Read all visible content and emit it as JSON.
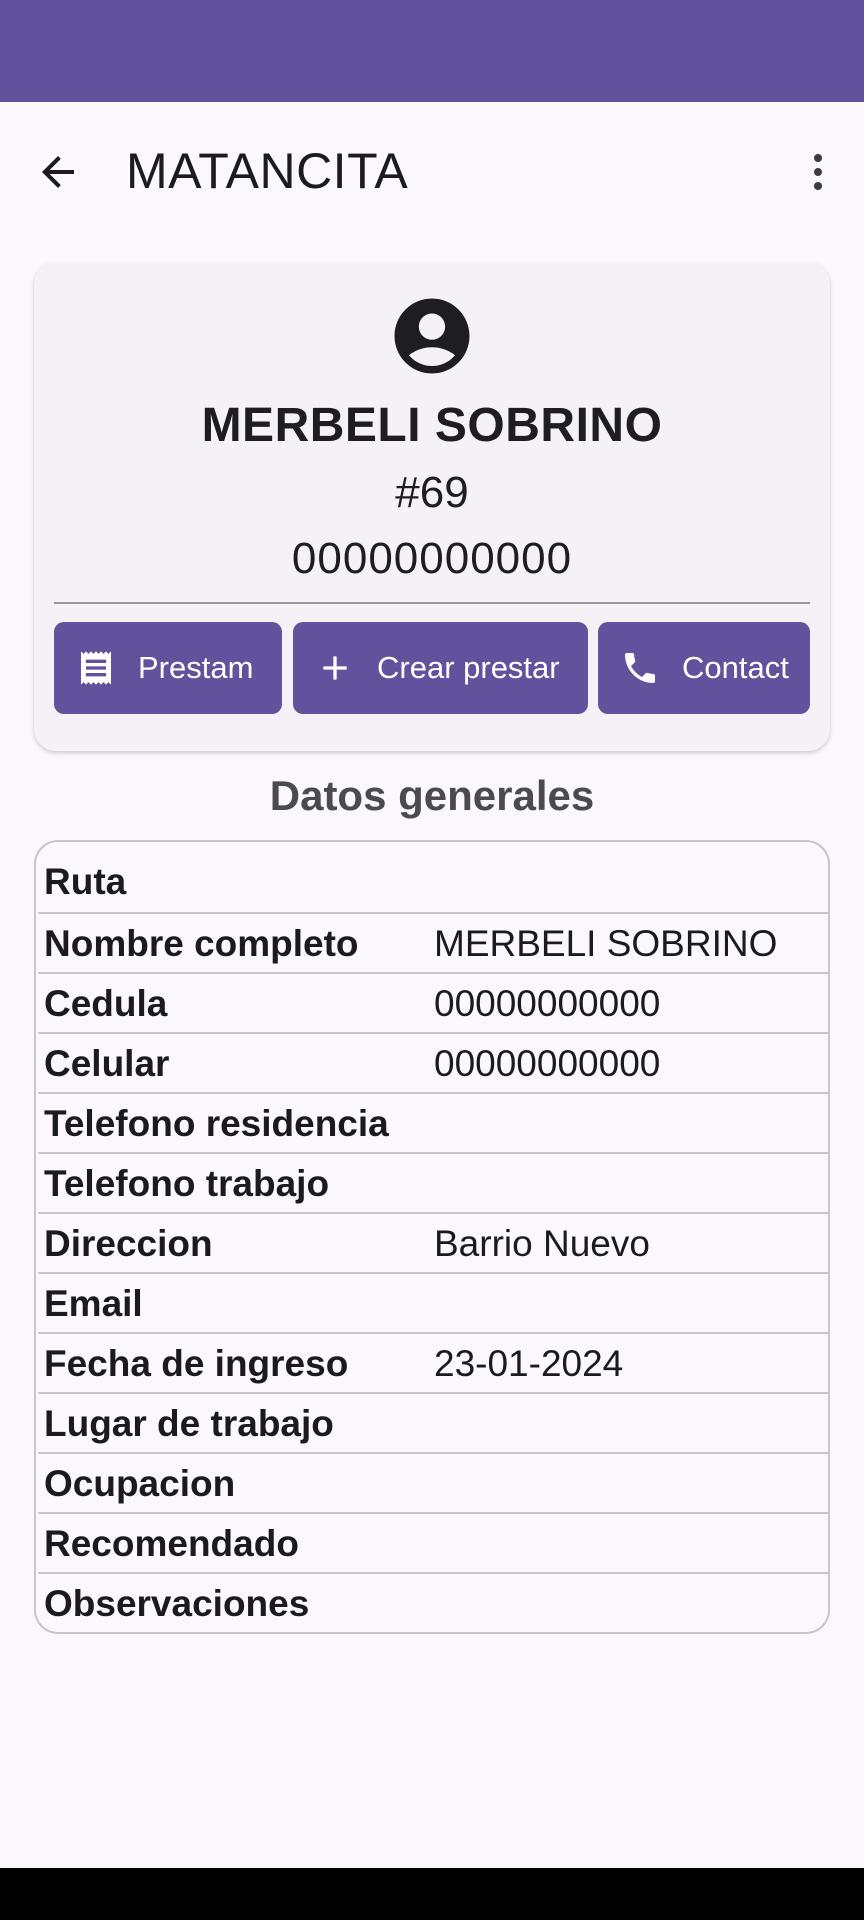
{
  "app_bar": {
    "title": "MATANCITA",
    "back_icon": "arrow-left-icon",
    "menu_icon": "more-vertical-icon"
  },
  "profile": {
    "avatar_icon": "account-circle-icon",
    "name": "MERBELI SOBRINO",
    "number": "#69",
    "cedula": "00000000000"
  },
  "actions": {
    "prestamos_label": "Prestam",
    "crear_label": "Crear prestar",
    "contactar_label": "Contact",
    "prestamos_icon": "receipt-icon",
    "crear_icon": "plus-icon",
    "contactar_icon": "phone-icon"
  },
  "section": {
    "title": "Datos generales"
  },
  "fields": [
    {
      "label": "Ruta",
      "value": ""
    },
    {
      "label": "Nombre completo",
      "value": "MERBELI SOBRINO"
    },
    {
      "label": "Cedula",
      "value": "00000000000"
    },
    {
      "label": "Celular",
      "value": "00000000000"
    },
    {
      "label": "Telefono residencia",
      "value": ""
    },
    {
      "label": "Telefono trabajo",
      "value": ""
    },
    {
      "label": "Direccion",
      "value": "Barrio Nuevo"
    },
    {
      "label": "Email",
      "value": ""
    },
    {
      "label": "Fecha de ingreso",
      "value": "23-01-2024"
    },
    {
      "label": "Lugar de trabajo",
      "value": ""
    },
    {
      "label": "Ocupacion",
      "value": ""
    },
    {
      "label": "Recomendado",
      "value": ""
    },
    {
      "label": "Observaciones",
      "value": ""
    }
  ],
  "colors": {
    "primary": "#62519d",
    "background": "#fcf7fd",
    "card": "#f4f2f7"
  }
}
